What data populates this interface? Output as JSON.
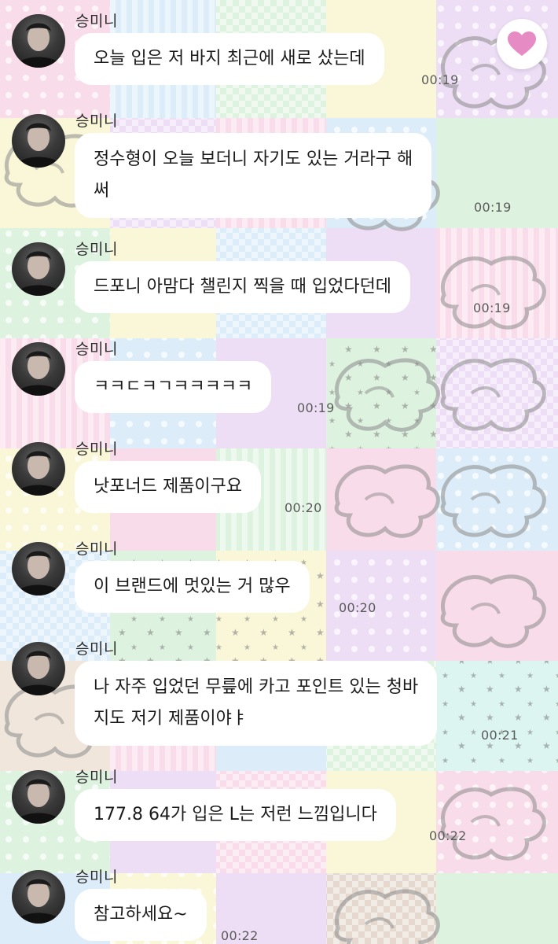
{
  "colors": {
    "bubble": "#ffffff",
    "heart": "#e68bc3",
    "timestamp": "#5a5a5a",
    "tile_pink": "#f6c9dd",
    "tile_blue": "#c9e4f6",
    "tile_green": "#cdeccf",
    "tile_yellow": "#f7f1c3",
    "tile_lavender": "#e3cdf2"
  },
  "header": {
    "heart_icon": "heart-icon"
  },
  "messages": [
    {
      "sender": "승미니",
      "lines": [
        "오늘 입은 저 바지 최근에 새로 샀는데"
      ],
      "time": "00:19"
    },
    {
      "sender": "승미니",
      "lines": [
        "정수형이 오늘 보더니 자기도 있는 거라구 해",
        "써"
      ],
      "time": "00:19"
    },
    {
      "sender": "승미니",
      "lines": [
        "드포니 아맘다 챌린지 찍을 때 입었다던데"
      ],
      "time": "00:19"
    },
    {
      "sender": "승미니",
      "lines": [
        "ㅋㅋㄷㅋㄱㅋㅋㅋㅋㅋ"
      ],
      "time": "00:19"
    },
    {
      "sender": "승미니",
      "lines": [
        "낫포너드 제품이구요"
      ],
      "time": "00:20"
    },
    {
      "sender": "승미니",
      "lines": [
        "이 브랜드에 멋있는 거 많우"
      ],
      "time": "00:20"
    },
    {
      "sender": "승미니",
      "lines": [
        "나 자주 입었던 무릎에 카고 포인트 있는 청바",
        "지도 저기 제품이야ㅑ"
      ],
      "time": "00:21"
    },
    {
      "sender": "승미니",
      "lines": [
        "177.8 64가 입은 L는 저런 느낌입니다"
      ],
      "time": "00:22"
    },
    {
      "sender": "승미니",
      "lines": [
        "참고하세요~"
      ],
      "time": "00:22"
    }
  ]
}
